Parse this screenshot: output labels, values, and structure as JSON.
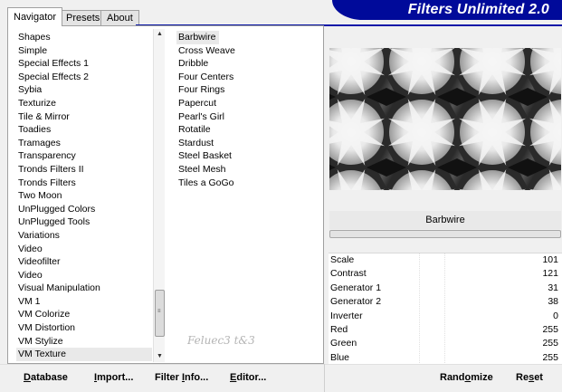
{
  "tabs": [
    "Navigator",
    "Presets",
    "About"
  ],
  "banner_title": "Filters Unlimited 2.0",
  "categories": [
    "Shapes",
    "Simple",
    "Special Effects 1",
    "Special Effects 2",
    "Sybia",
    "Texturize",
    "Tile & Mirror",
    "Toadies",
    "Tramages",
    "Transparency",
    "Tronds Filters II",
    "Tronds Filters",
    "Two Moon",
    "UnPlugged Colors",
    "UnPlugged Tools",
    "Variations",
    "Video",
    "Videofilter",
    "Video",
    "Visual Manipulation",
    "VM 1",
    "VM Colorize",
    "VM Distortion",
    "VM Stylize",
    "VM Texture"
  ],
  "selected_category": "VM Texture",
  "filters": [
    "Barbwire",
    "Cross Weave",
    "Dribble",
    "Four Centers",
    "Four Rings",
    "Papercut",
    "Pearl's Girl",
    "Rotatile",
    "Stardust",
    "Steel Basket",
    "Steel Mesh",
    "Tiles a GoGo"
  ],
  "selected_filter": "Barbwire",
  "watermark_text": "Feluec3 t&3",
  "preview": {
    "filter_name": "Barbwire",
    "progress": 0
  },
  "params": [
    {
      "label": "Scale",
      "value": "101"
    },
    {
      "label": "Contrast",
      "value": "121"
    },
    {
      "label": "Generator 1",
      "value": "31"
    },
    {
      "label": "Generator 2",
      "value": "38"
    },
    {
      "label": "Inverter",
      "value": "0"
    },
    {
      "label": "Red",
      "value": "255"
    },
    {
      "label": "Green",
      "value": "255"
    },
    {
      "label": "Blue",
      "value": "255"
    }
  ],
  "buttons": {
    "database": {
      "accel": "D",
      "rest": "atabase"
    },
    "import": {
      "accel": "I",
      "rest": "mport..."
    },
    "filter_info": {
      "pre": "Filter ",
      "accel": "I",
      "rest": "nfo..."
    },
    "editor": {
      "accel": "E",
      "rest": "ditor..."
    },
    "randomize": {
      "pre": "Rand",
      "accel": "o",
      "rest": "mize"
    },
    "reset": {
      "pre": "Re",
      "accel": "s",
      "rest": "et"
    }
  },
  "colors": {
    "banner": "#000a9a",
    "selection": "#e9e9e9"
  },
  "icons": {
    "scroll_up": "triangle-up-icon",
    "scroll_down": "triangle-down-icon",
    "thumb_grip": "grip-icon"
  }
}
